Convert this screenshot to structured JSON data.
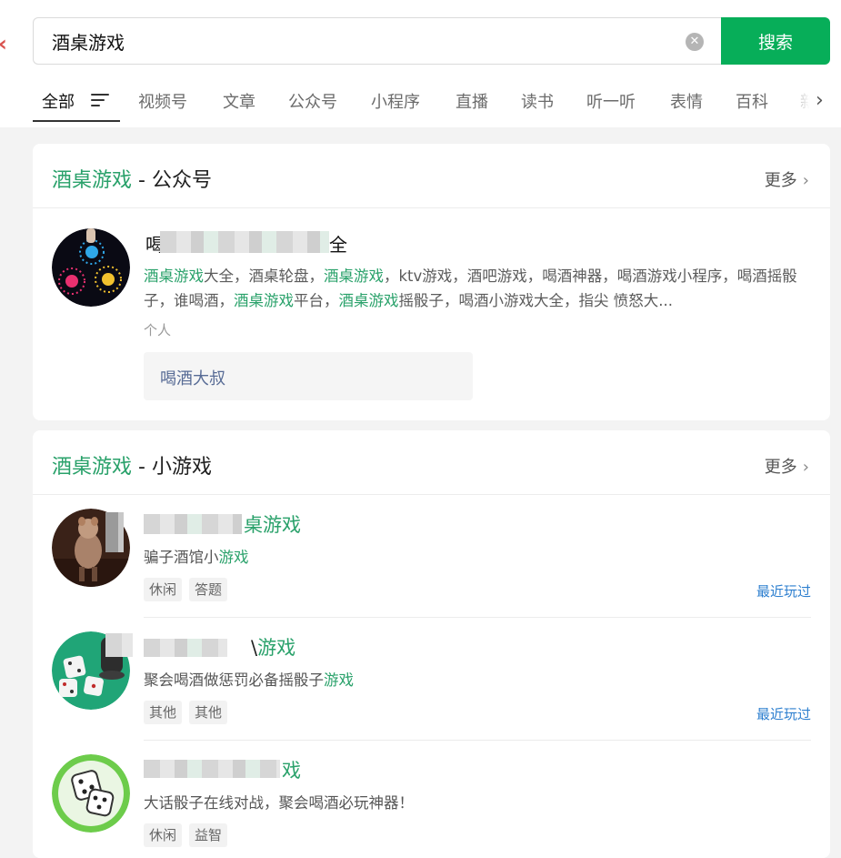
{
  "search": {
    "query": "酒桌游戏",
    "button_label": "搜索"
  },
  "tabs": [
    {
      "label": "全部",
      "active": true
    },
    {
      "label": "视频号"
    },
    {
      "label": "文章"
    },
    {
      "label": "公众号"
    },
    {
      "label": "小程序"
    },
    {
      "label": "直播"
    },
    {
      "label": "读书"
    },
    {
      "label": "听一听"
    },
    {
      "label": "表情"
    },
    {
      "label": "百科"
    },
    {
      "label": "新"
    }
  ],
  "official_accounts": {
    "title_highlight": "酒桌游戏",
    "title_rest": " - 公众号",
    "more_label": "更多",
    "account": {
      "name_visible_start": "喝",
      "name_visible_end": "全",
      "description_parts": [
        {
          "text": "酒桌游戏",
          "hl": true
        },
        {
          "text": "大全，酒桌轮盘，"
        },
        {
          "text": "酒桌游戏",
          "hl": true
        },
        {
          "text": "，ktv游戏，酒吧游戏，喝酒神器，喝酒游戏小程序，喝酒摇骰子，谁喝酒，"
        },
        {
          "text": "酒桌游戏",
          "hl": true
        },
        {
          "text": "平台，"
        },
        {
          "text": "酒桌游戏",
          "hl": true
        },
        {
          "text": "摇骰子，喝酒小游戏大全，指尖 愤怒大..."
        }
      ],
      "type": "个人",
      "related_chip": "喝酒大叔"
    }
  },
  "mini_games": {
    "title_highlight": "酒桌游戏",
    "title_rest": " - 小游戏",
    "more_label": "更多",
    "items": [
      {
        "title_visible": "桌游戏",
        "desc_parts": [
          {
            "text": "骗子酒馆小"
          },
          {
            "text": "游戏",
            "hl": true
          }
        ],
        "tags": [
          "休闲",
          "答题"
        ],
        "recent": "最近玩过"
      },
      {
        "title_visible": "游戏",
        "title_tail_black": "\\",
        "desc_parts": [
          {
            "text": "聚会喝酒做惩罚必备摇骰子"
          },
          {
            "text": "游戏",
            "hl": true
          }
        ],
        "tags": [
          "其他",
          "其他"
        ],
        "recent": "最近玩过"
      },
      {
        "title_visible": "戏",
        "desc_parts": [
          {
            "text": "大话骰子在线对战，聚会喝酒必玩神器！"
          }
        ],
        "tags": [
          "休闲",
          "益智"
        ],
        "recent": ""
      }
    ]
  },
  "colors": {
    "accent": "#07ae59",
    "highlight": "#29a16a",
    "link": "#2d7fcf",
    "chip_link": "#576b95"
  }
}
